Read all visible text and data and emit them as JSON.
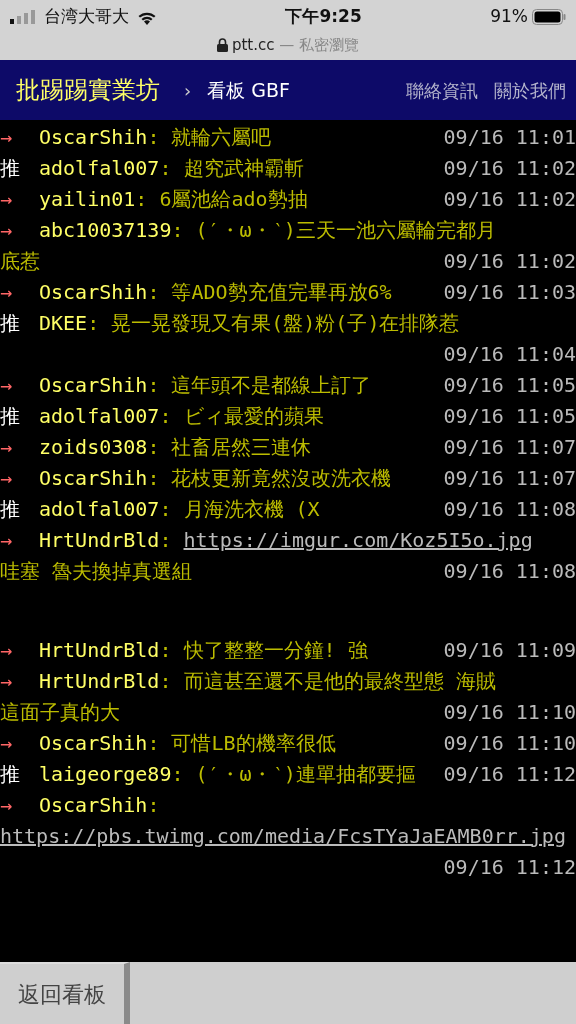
{
  "status_bar": {
    "carrier": "台湾大哥大",
    "time": "下午9:25",
    "battery": "91%"
  },
  "browser": {
    "domain": "ptt.cc",
    "mode": "— 私密瀏覽"
  },
  "navbar": {
    "brand": "批踢踢實業坊",
    "separator": "›",
    "board": "看板 GBF",
    "links": [
      "聯絡資訊",
      "關於我們"
    ]
  },
  "pushes": [
    {
      "kind": "arrow",
      "tag": "→",
      "user": "OscarShih",
      "content": [
        {
          "kind": "text",
          "text": ": 就輪六屬吧"
        }
      ],
      "time": "09/16 11:01"
    },
    {
      "kind": "push",
      "tag": "推",
      "user": "adolfal007",
      "content": [
        {
          "kind": "text",
          "text": ": 超究武神霸斬"
        }
      ],
      "time": "09/16 11:02"
    },
    {
      "kind": "arrow",
      "tag": "→",
      "user": "yailin01",
      "content": [
        {
          "kind": "text",
          "text": ": 6屬池給ado勢抽"
        }
      ],
      "time": "09/16 11:02"
    },
    {
      "kind": "arrow",
      "tag": "→",
      "user": "abc10037139",
      "content": [
        {
          "kind": "text",
          "text": ": (′・ω・‵)三天一池六屬輪完都月"
        },
        {
          "kind": "text",
          "text": "底惹",
          "newline": true
        }
      ],
      "time": "09/16 11:02"
    },
    {
      "kind": "arrow",
      "tag": "→",
      "user": "OscarShih",
      "content": [
        {
          "kind": "text",
          "text": ": 等ADO勢充值完畢再放6%"
        }
      ],
      "time": "09/16 11:03"
    },
    {
      "kind": "push",
      "tag": "推",
      "user": "DKEE",
      "content": [
        {
          "kind": "text",
          "text": ": 晃一晃發現又有果(盤)粉(子)在排隊惹"
        }
      ],
      "time": "09/16 11:04"
    },
    {
      "kind": "arrow",
      "tag": "→",
      "user": "OscarShih",
      "content": [
        {
          "kind": "text",
          "text": ": 這年頭不是都線上訂了"
        }
      ],
      "time": "09/16 11:05"
    },
    {
      "kind": "push",
      "tag": "推",
      "user": "adolfal007",
      "content": [
        {
          "kind": "text",
          "text": ": ビィ最愛的蘋果"
        }
      ],
      "time": "09/16 11:05"
    },
    {
      "kind": "arrow",
      "tag": "→",
      "user": "zoids0308",
      "content": [
        {
          "kind": "text",
          "text": ": 社畜居然三連休"
        }
      ],
      "time": "09/16 11:07"
    },
    {
      "kind": "arrow",
      "tag": "→",
      "user": "OscarShih",
      "content": [
        {
          "kind": "text",
          "text": ": 花枝更新竟然沒改洗衣機"
        }
      ],
      "time": "09/16 11:07"
    },
    {
      "kind": "push",
      "tag": "推",
      "user": "adolfal007",
      "content": [
        {
          "kind": "text",
          "text": ": 月海洗衣機 (X"
        }
      ],
      "time": "09/16 11:08"
    },
    {
      "kind": "arrow",
      "tag": "→",
      "user": "HrtUndrBld",
      "content": [
        {
          "kind": "text",
          "text": ": "
        },
        {
          "kind": "link",
          "text": "https://imgur.com/Koz5I5o.jpg"
        },
        {
          "kind": "text",
          "text": "哇塞 魯夫換掉真選組",
          "newline": true
        }
      ],
      "time": "09/16 11:08",
      "preview": true
    },
    {
      "kind": "arrow",
      "tag": "→",
      "user": "HrtUndrBld",
      "content": [
        {
          "kind": "text",
          "text": ": 快了整整一分鐘! 強"
        }
      ],
      "time": "09/16 11:09"
    },
    {
      "kind": "arrow",
      "tag": "→",
      "user": "HrtUndrBld",
      "content": [
        {
          "kind": "text",
          "text": ": 而這甚至還不是他的最終型態 海賊"
        },
        {
          "kind": "text",
          "text": "這面子真的大",
          "newline": true
        }
      ],
      "time": "09/16 11:10"
    },
    {
      "kind": "arrow",
      "tag": "→",
      "user": "OscarShih",
      "content": [
        {
          "kind": "text",
          "text": ": 可惜LB的機率很低"
        }
      ],
      "time": "09/16 11:10"
    },
    {
      "kind": "push",
      "tag": "推",
      "user": "laigeorge89",
      "content": [
        {
          "kind": "text",
          "text": ": (′・ω・‵)連單抽都要摳"
        }
      ],
      "time": "09/16 11:12"
    },
    {
      "kind": "arrow",
      "tag": "→",
      "user": "OscarShih",
      "content": [
        {
          "kind": "text",
          "text": ": "
        },
        {
          "kind": "link",
          "text": "https://pbs.twimg.com/media/FcsTYaJaEAMB0rr.jpg",
          "newline": true
        }
      ],
      "time": "09/16 11:12"
    }
  ],
  "footer": {
    "back_button": "返回看板"
  }
}
